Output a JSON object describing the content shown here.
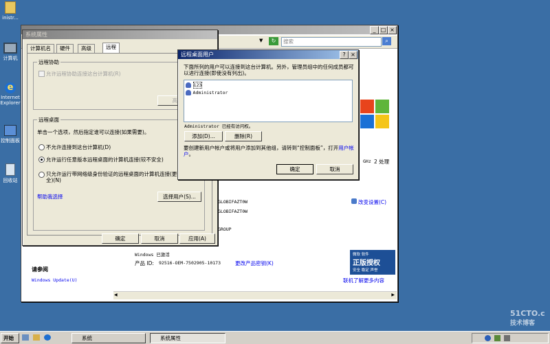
{
  "desktop": {
    "icons": [
      {
        "label": "inistr..."
      },
      {
        "label": "计算机"
      },
      {
        "label": "Internet\nExplorer"
      },
      {
        "label": "控制面板"
      },
      {
        "label": "回收站"
      }
    ]
  },
  "bg_window": {
    "search_placeholder": "搜索",
    "processor_speed": "GHz",
    "processor_extra": "2 处理",
    "change_settings": "改变设置(C)",
    "computer_names": [
      "GLOBIFAZT0W",
      "GLOBIFAZT0W",
      "GROUP"
    ],
    "windows_activated": "Windows 已激活",
    "product_id_label": "产品 ID:",
    "product_id_value": "92516-OEM-7502905-10173",
    "change_product_key": "更改产品密钥(K)",
    "see_also": "请参阅",
    "windows_update": "Windows Update(U)",
    "genuine_line1": "正版授权",
    "genuine_top": "微软 软件",
    "genuine_sub": "安全 稳定 声誉",
    "learn_more": "联机了解更多内容"
  },
  "sys_props": {
    "title": "系统属性",
    "tabs": [
      "计算机名",
      "硬件",
      "高级",
      "远程"
    ],
    "remote_assist_group": "远程协助",
    "allow_remote_assist": "允许远程协助连接这台计算机(R)",
    "advanced_btn": "高级",
    "remote_desktop_group": "远程桌面",
    "rd_instruction": "单击一个选项，然后指定谁可以连接(如果需要)。",
    "opt_no": "不允许连接到这台计算机(D)",
    "opt_any": "允许运行任意版本远程桌面的计算机连接(较不安全)",
    "opt_nla": "只允许运行带网络级身份验证的远程桌面的计算机连接(更安全)(N)",
    "help_link": "帮助我选择",
    "select_users_btn": "选择用户(S)...",
    "ok": "确定",
    "cancel": "取消",
    "apply": "应用(A)"
  },
  "rd_users": {
    "title": "远程桌面用户",
    "help_btn": "?",
    "close_btn": "×",
    "description": "下面所列的用户可以连接到这台计算机。另外，管理员组中的任何成员都可以进行连接(即使没有列出)。",
    "users": [
      "123",
      "Administrator"
    ],
    "admin_access": "Administrator 已经有访问权。",
    "add": "添加(D)...",
    "remove": "删除(R)",
    "note_prefix": "要创建新用户帐户或将用户添加到其他组，请转到“控制面板”，打开",
    "note_link": "用户帐户",
    "note_suffix": "。",
    "ok": "确定",
    "cancel": "取消"
  },
  "taskbar": {
    "start": "开始",
    "tasks": [
      "系统",
      "系统属性"
    ]
  },
  "watermark": {
    "line1": "51CTO.c",
    "line2": "技术博客"
  }
}
